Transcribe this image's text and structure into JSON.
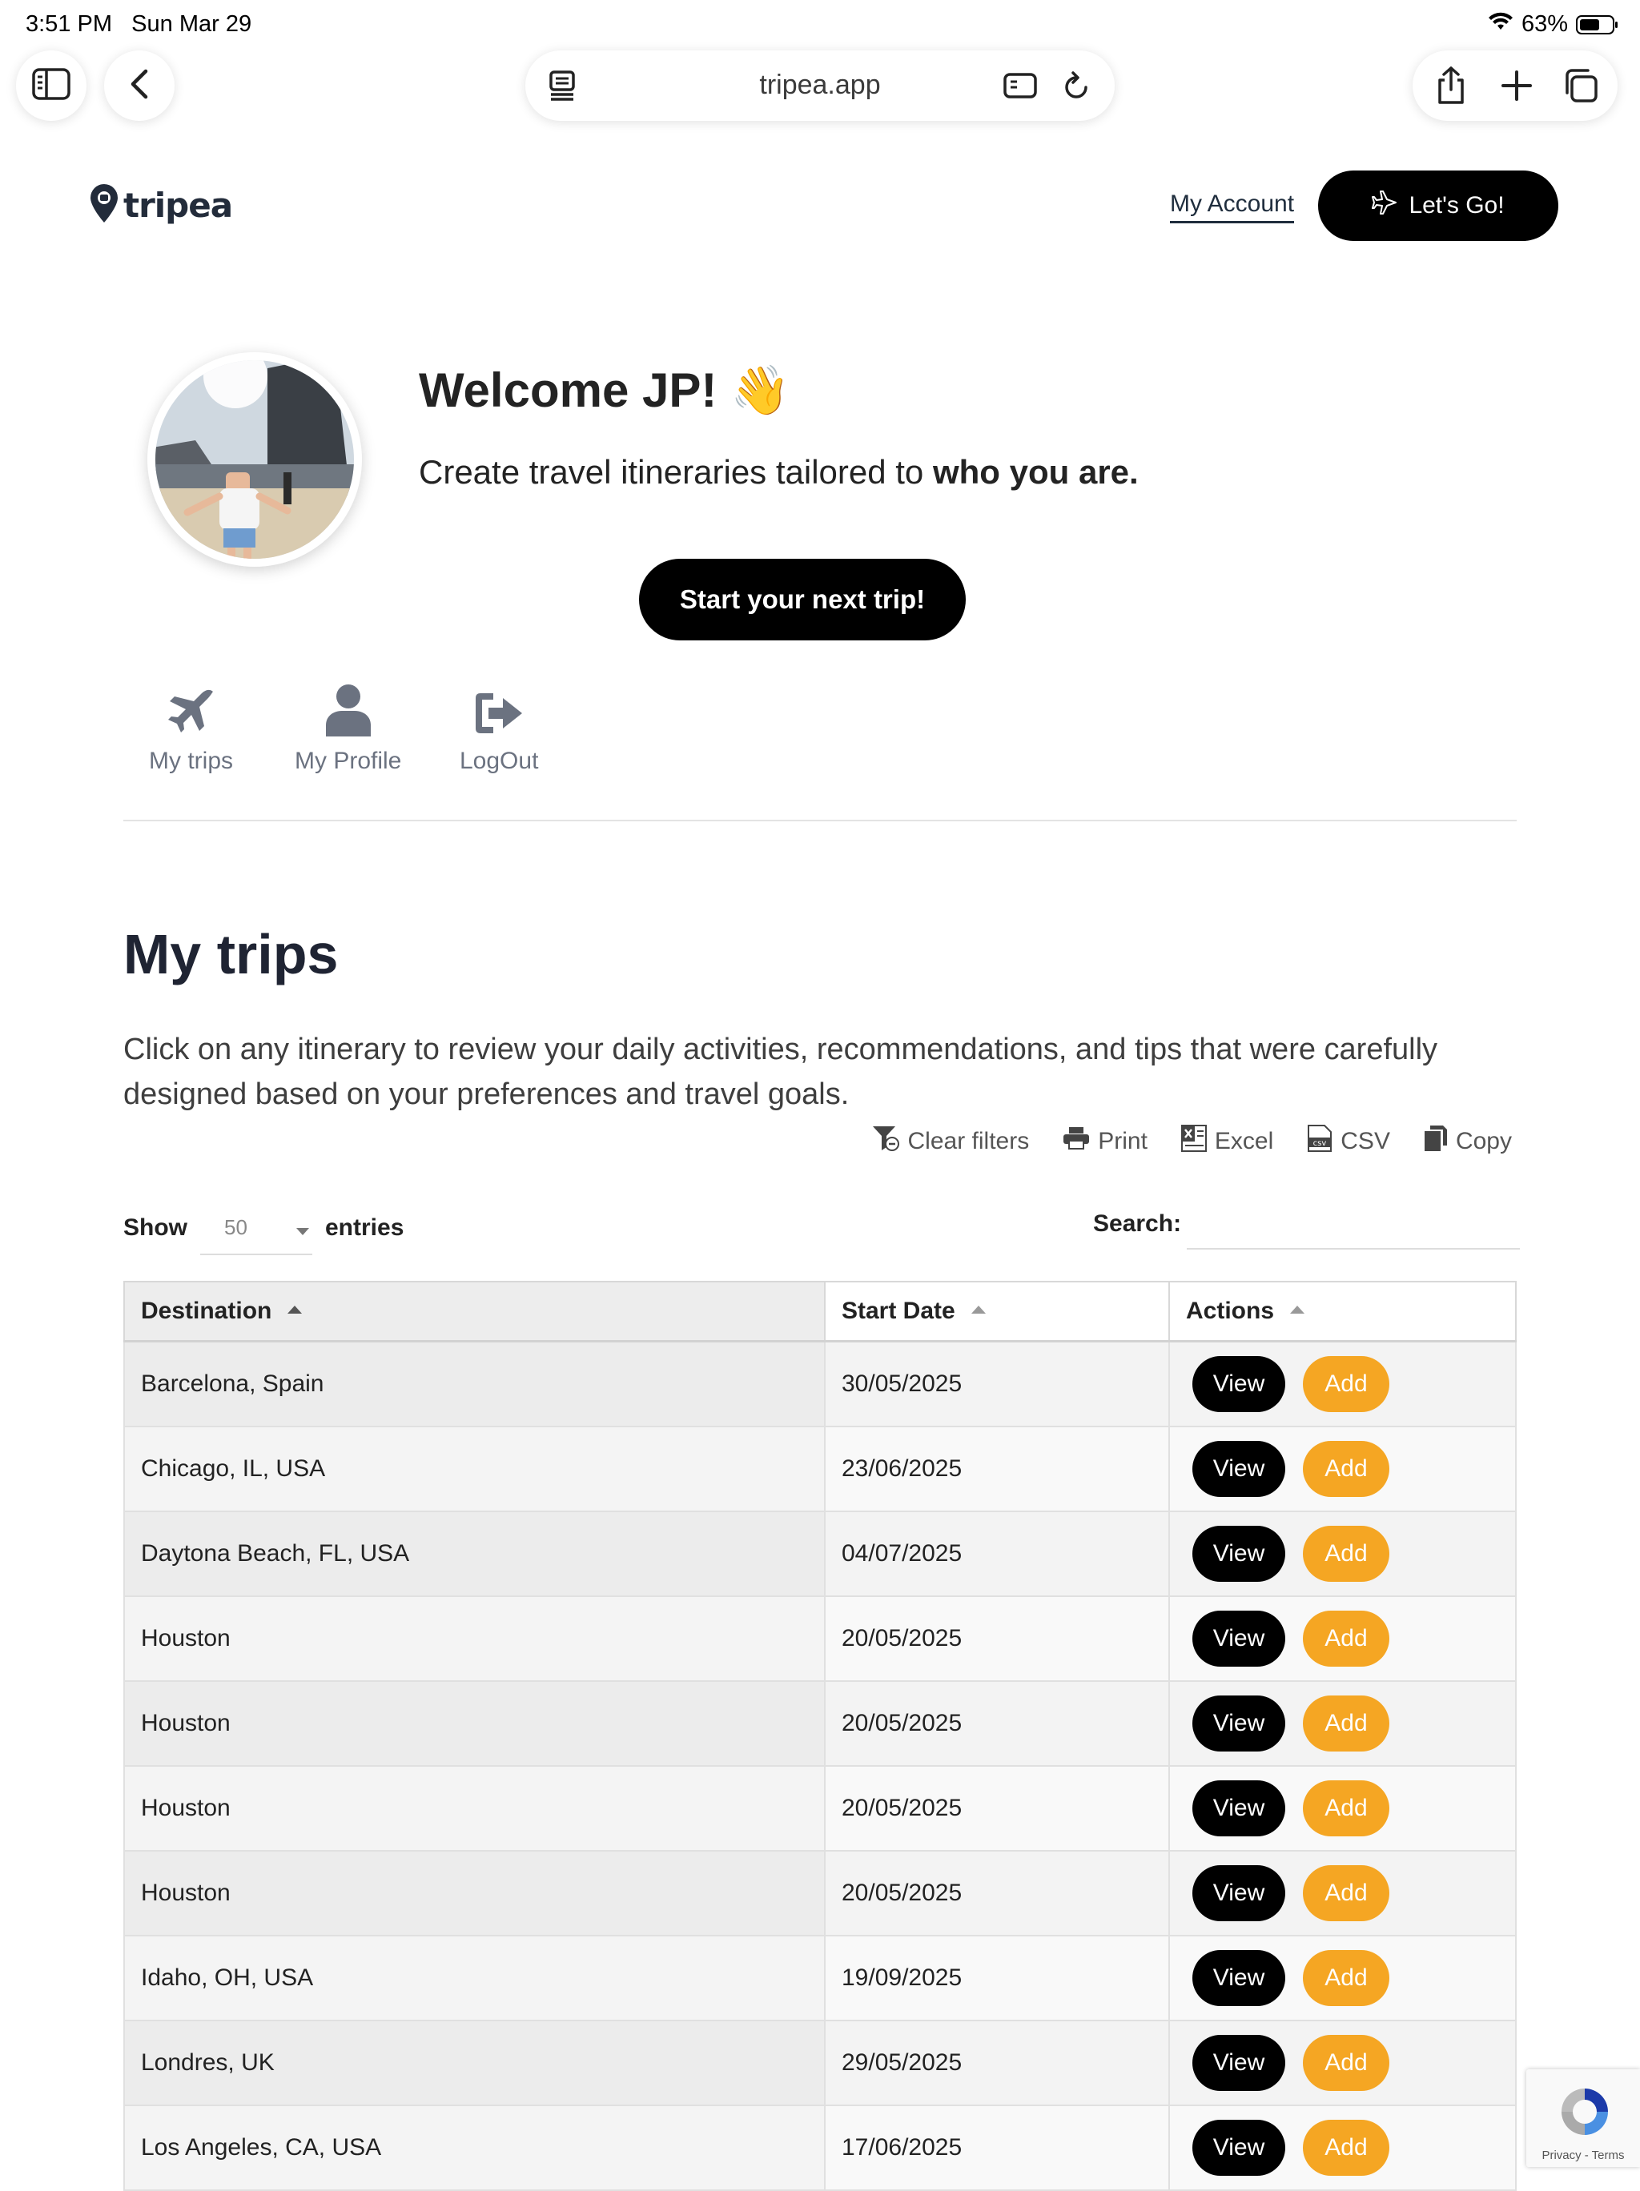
{
  "status_bar": {
    "time": "3:51 PM",
    "date": "Sun Mar 29",
    "battery": "63%",
    "battery_level": 0.63
  },
  "browser": {
    "url": "tripea.app"
  },
  "site": {
    "logo_text": "tripea",
    "my_account": "My Account",
    "lets_go": "Let's Go!"
  },
  "welcome": {
    "title": "Welcome JP! 👋",
    "subtitle_prefix": "Create travel itineraries tailored to ",
    "subtitle_bold": "who you are.",
    "start_button": "Start your next trip!"
  },
  "quick_nav": [
    {
      "label": "My trips",
      "icon": "plane-icon"
    },
    {
      "label": "My Profile",
      "icon": "user-icon"
    },
    {
      "label": "LogOut",
      "icon": "logout-icon"
    }
  ],
  "trips": {
    "title": "My trips",
    "description": "Click on any itinerary to review your daily activities, recommendations, and tips that were carefully designed based on your preferences and travel goals.",
    "tools": [
      "Clear filters",
      "Print",
      "Excel",
      "CSV",
      "Copy"
    ],
    "show_label": "Show",
    "entries_value": "50",
    "entries_label": "entries",
    "search_label": "Search:",
    "columns": [
      "Destination",
      "Start Date",
      "Actions"
    ],
    "view_label": "View",
    "add_label": "Add",
    "rows": [
      {
        "destination": "Barcelona, Spain",
        "start_date": "30/05/2025"
      },
      {
        "destination": "Chicago, IL, USA",
        "start_date": "23/06/2025"
      },
      {
        "destination": "Daytona Beach, FL, USA",
        "start_date": "04/07/2025"
      },
      {
        "destination": "Houston",
        "start_date": "20/05/2025"
      },
      {
        "destination": "Houston",
        "start_date": "20/05/2025"
      },
      {
        "destination": "Houston",
        "start_date": "20/05/2025"
      },
      {
        "destination": "Houston",
        "start_date": "20/05/2025"
      },
      {
        "destination": "Idaho, OH, USA",
        "start_date": "19/09/2025"
      },
      {
        "destination": "Londres, UK",
        "start_date": "29/05/2025"
      },
      {
        "destination": "Los Angeles, CA, USA",
        "start_date": "17/06/2025"
      }
    ]
  },
  "recaptcha": {
    "text": "Privacy - Terms"
  },
  "colors": {
    "accent": "#f5a623",
    "primary": "#000000",
    "text": "#232323"
  }
}
